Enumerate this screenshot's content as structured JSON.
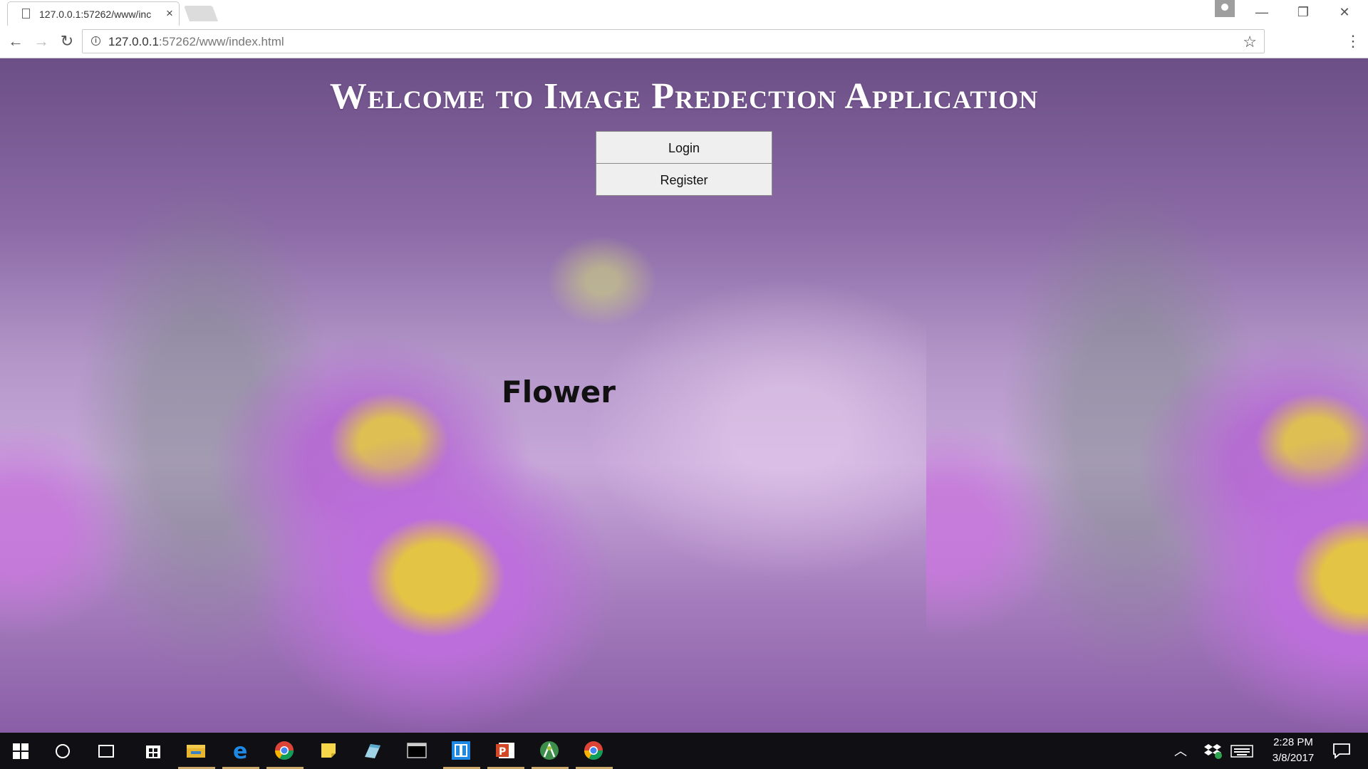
{
  "browser": {
    "tab_title": "127.0.0.1:57262/www/inc",
    "url_host": "127.0.0.1",
    "url_path": ":57262/www/index.html"
  },
  "page": {
    "heading": "Welcome to Image Predection Application",
    "login_label": "Login",
    "register_label": "Register",
    "prediction_label": "Flower"
  },
  "taskbar": {
    "time": "2:28 PM",
    "date": "3/8/2017",
    "pinned_apps": [
      "file-explorer-icon",
      "edge-icon",
      "chrome-icon",
      "sticky-notes-icon",
      "snipping-icon",
      "terminal-icon",
      "remote-app-icon",
      "powerpoint-icon",
      "android-studio-icon",
      "chrome-icon"
    ]
  },
  "colors": {
    "heading": "#ffffff",
    "button_bg": "#efefef",
    "taskbar_bg": "#101014",
    "taskbar_active": "#c9a86a"
  }
}
